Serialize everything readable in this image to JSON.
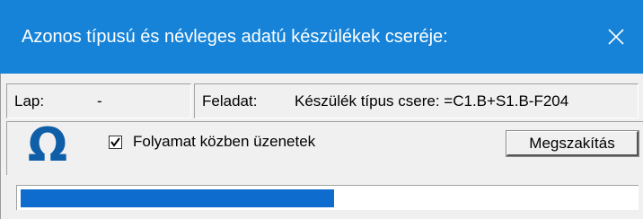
{
  "window": {
    "title": "Azonos típusú és névleges adatú készülékek cseréje:",
    "close_symbol": "✕",
    "titlebar_color": "#1683d8"
  },
  "status": {
    "lap_label": "Lap:",
    "lap_value": "-",
    "feladat_label": "Feladat:",
    "feladat_value": "Készülék típus csere: =C1.B+S1.B-F204"
  },
  "options": {
    "icon": "omega-icon",
    "checkbox_label": "Folyamat közben üzenetek",
    "checkbox_checked": true
  },
  "actions": {
    "cancel_label": "Megszakítás"
  },
  "progress": {
    "fraction": 0.51,
    "color": "#0f6ccf"
  }
}
